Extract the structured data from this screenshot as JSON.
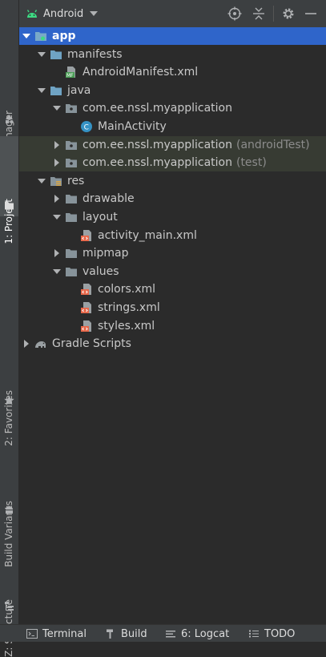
{
  "side_tabs": [
    {
      "label": "Resource Manager"
    },
    {
      "label": "1: Project"
    },
    {
      "label": "2: Favorites"
    },
    {
      "label": "Build Variants"
    },
    {
      "label": "Z: Structure"
    }
  ],
  "toolbar": {
    "view_mode": "Android"
  },
  "tree": [
    {
      "label": "app",
      "suffix": ""
    },
    {
      "label": "manifests",
      "suffix": ""
    },
    {
      "label": "AndroidManifest.xml",
      "suffix": ""
    },
    {
      "label": "java",
      "suffix": ""
    },
    {
      "label": "com.ee.nssl.myapplication",
      "suffix": ""
    },
    {
      "label": "MainActivity",
      "suffix": ""
    },
    {
      "label": "com.ee.nssl.myapplication",
      "suffix": "(androidTest)"
    },
    {
      "label": "com.ee.nssl.myapplication",
      "suffix": "(test)"
    },
    {
      "label": "res",
      "suffix": ""
    },
    {
      "label": "drawable",
      "suffix": ""
    },
    {
      "label": "layout",
      "suffix": ""
    },
    {
      "label": "activity_main.xml",
      "suffix": ""
    },
    {
      "label": "mipmap",
      "suffix": ""
    },
    {
      "label": "values",
      "suffix": ""
    },
    {
      "label": "colors.xml",
      "suffix": ""
    },
    {
      "label": "strings.xml",
      "suffix": ""
    },
    {
      "label": "styles.xml",
      "suffix": ""
    },
    {
      "label": "Gradle Scripts",
      "suffix": ""
    }
  ],
  "bottom_bar": [
    {
      "label": "Terminal"
    },
    {
      "label": "Build"
    },
    {
      "label": "6: Logcat"
    },
    {
      "label": "TODO"
    }
  ]
}
